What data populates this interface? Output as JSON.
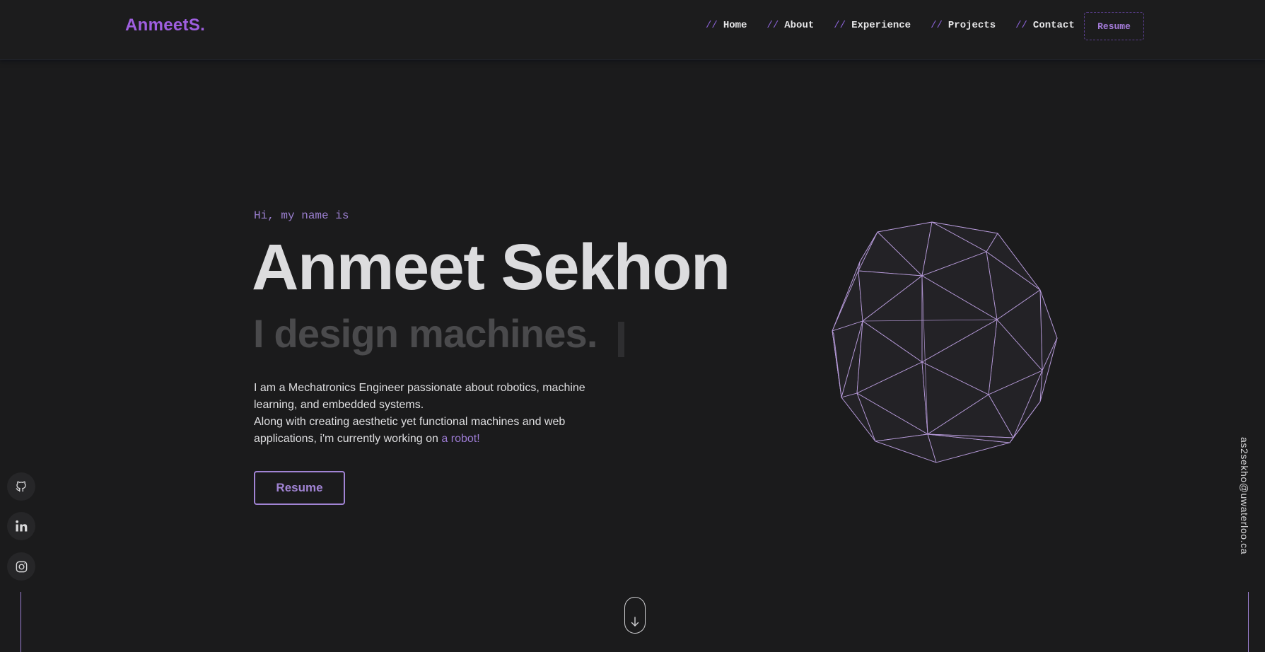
{
  "header": {
    "logo": "AnmeetS.",
    "nav": [
      {
        "prefix": "//",
        "label": "Home"
      },
      {
        "prefix": "//",
        "label": "About"
      },
      {
        "prefix": "//",
        "label": "Experience"
      },
      {
        "prefix": "//",
        "label": "Projects"
      },
      {
        "prefix": "//",
        "label": "Contact"
      }
    ],
    "resume_label": "Resume"
  },
  "hero": {
    "greeting": "Hi, my name is",
    "name": "Anmeet Sekhon",
    "tagline": "I design machines.",
    "bio_line1": "I am a Mechatronics Engineer passionate about robotics, machine learning, and embedded systems.",
    "bio_line2_prefix": "Along with creating aesthetic yet functional machines and web applications, i'm currently working on ",
    "bio_link": "a robot!",
    "resume_button": "Resume"
  },
  "social": {
    "icons": [
      "github-icon",
      "linkedin-icon",
      "instagram-icon"
    ]
  },
  "email": "as2sekho@uwaterloo.ca",
  "colors": {
    "background": "#1b1b1c",
    "accent": "#9f5fe0",
    "accent_soft": "#a184d4",
    "text": "#dcdcde",
    "tagline": "#4a4a4c"
  }
}
